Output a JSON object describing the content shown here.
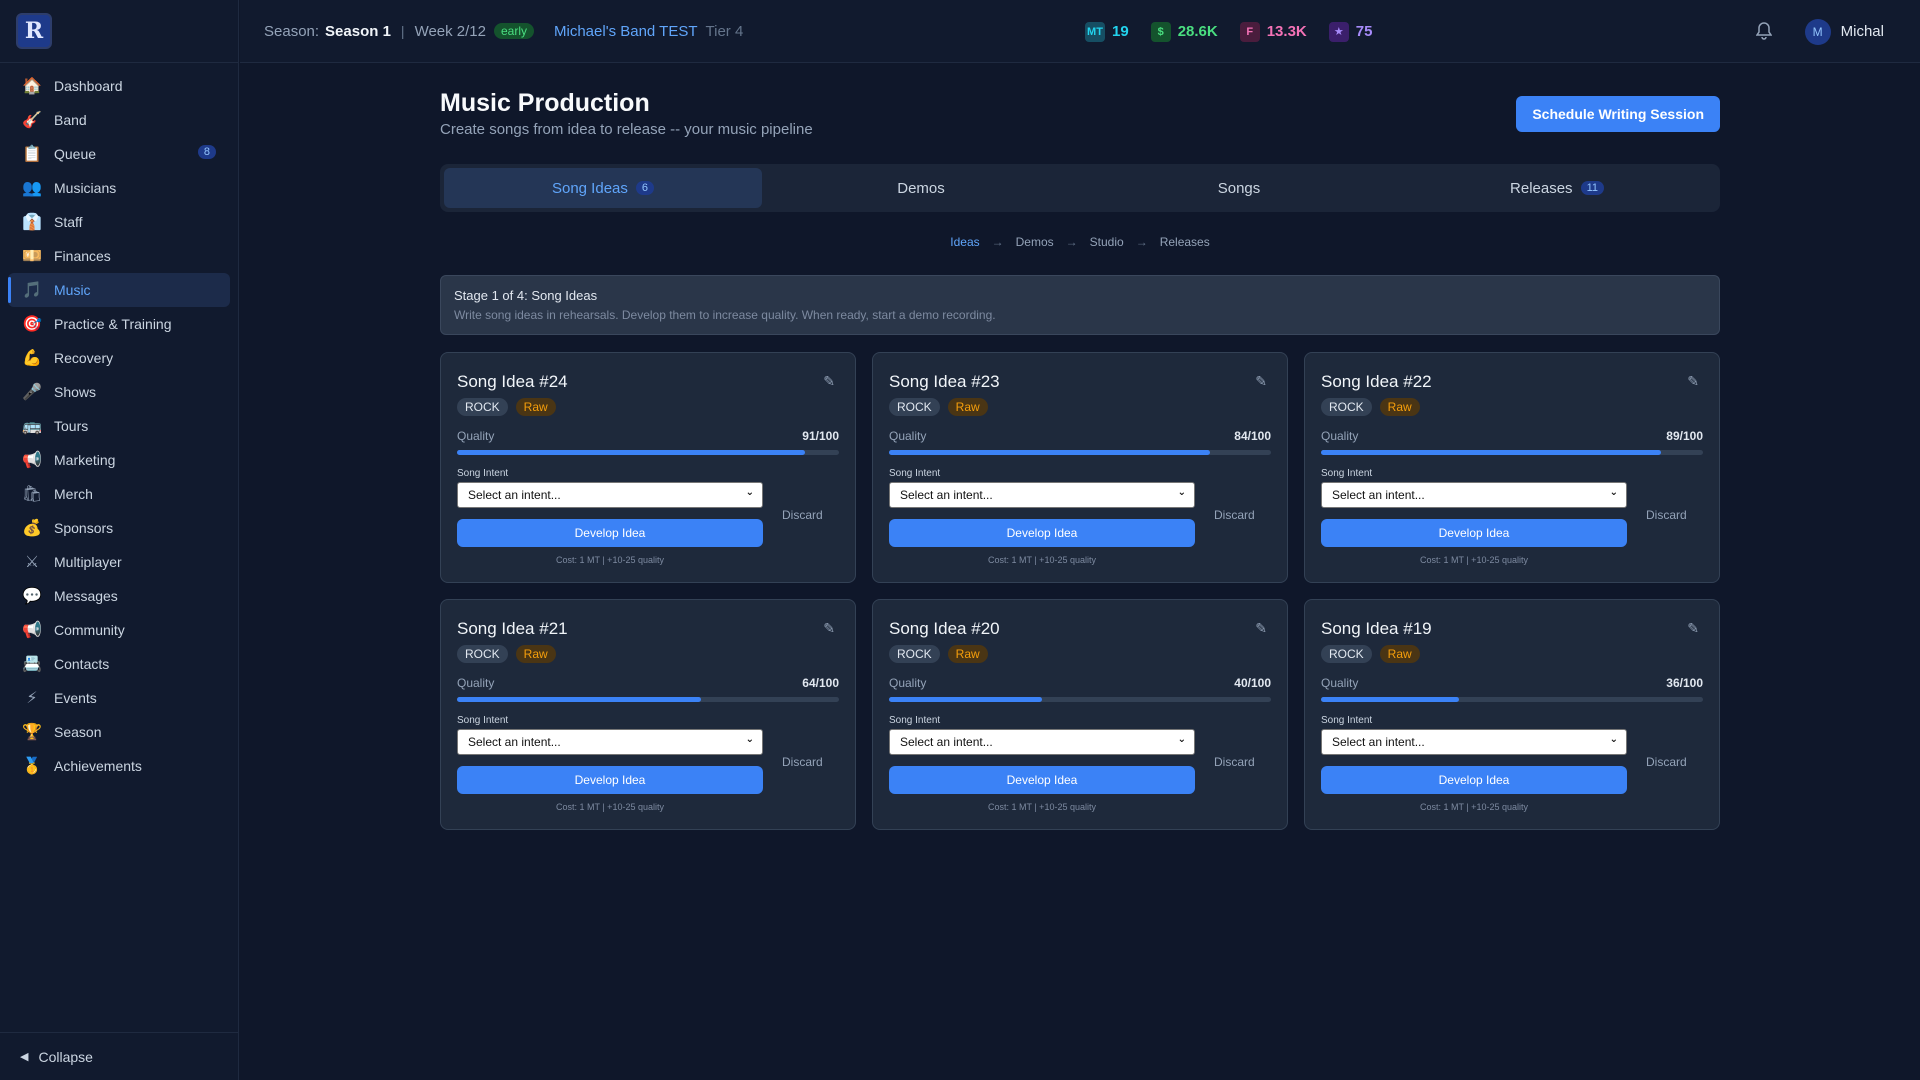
{
  "sidebar": {
    "logo_letter": "R",
    "items": [
      {
        "label": "Dashboard",
        "icon": "🏠",
        "icon_name": "home-icon"
      },
      {
        "label": "Band",
        "icon": "🎸",
        "icon_name": "guitar-icon"
      },
      {
        "label": "Queue",
        "icon": "📋",
        "icon_name": "clipboard-icon",
        "badge": "8"
      },
      {
        "label": "Musicians",
        "icon": "👥",
        "icon_name": "people-icon"
      },
      {
        "label": "Staff",
        "icon": "👔",
        "icon_name": "tie-icon"
      },
      {
        "label": "Finances",
        "icon": "💴",
        "icon_name": "money-icon"
      },
      {
        "label": "Music",
        "icon": "🎵",
        "icon_name": "music-note-icon",
        "active": true
      },
      {
        "label": "Practice & Training",
        "icon": "🎯",
        "icon_name": "target-icon"
      },
      {
        "label": "Recovery",
        "icon": "💪",
        "icon_name": "muscle-icon"
      },
      {
        "label": "Shows",
        "icon": "🎤",
        "icon_name": "microphone-icon"
      },
      {
        "label": "Tours",
        "icon": "🚌",
        "icon_name": "bus-icon"
      },
      {
        "label": "Marketing",
        "icon": "📢",
        "icon_name": "megaphone-icon"
      },
      {
        "label": "Merch",
        "icon": "🛍",
        "icon_name": "shopping-bag-icon"
      },
      {
        "label": "Sponsors",
        "icon": "💰",
        "icon_name": "money-bag-icon"
      },
      {
        "label": "Multiplayer",
        "icon": "⚔",
        "icon_name": "swords-icon"
      },
      {
        "label": "Messages",
        "icon": "💬",
        "icon_name": "chat-icon"
      },
      {
        "label": "Community",
        "icon": "📢",
        "icon_name": "megaphone-icon"
      },
      {
        "label": "Contacts",
        "icon": "📇",
        "icon_name": "card-index-icon"
      },
      {
        "label": "Events",
        "icon": "⚡",
        "icon_name": "lightning-icon"
      },
      {
        "label": "Season",
        "icon": "🏆",
        "icon_name": "trophy-icon"
      },
      {
        "label": "Achievements",
        "icon": "🥇",
        "icon_name": "medal-icon"
      }
    ],
    "collapse_label": "Collapse"
  },
  "topbar": {
    "season_label": "Season:",
    "season_value": "Season 1",
    "week": "Week 2/12",
    "phase": "early",
    "band_name": "Michael's Band TEST",
    "tier": "Tier 4",
    "stats": {
      "mt": {
        "chip": "MT",
        "value": "19"
      },
      "money": {
        "chip": "$",
        "value": "28.6K"
      },
      "fans": {
        "chip": "F",
        "value": "13.3K"
      },
      "star": {
        "chip": "★",
        "value": "75"
      }
    },
    "user_initial": "M",
    "user_name": "Michal"
  },
  "main": {
    "title": "Music Production",
    "subtitle": "Create songs from idea to release -- your music pipeline",
    "schedule_button": "Schedule Writing Session",
    "tabs": [
      {
        "label": "Song Ideas",
        "count": "6",
        "active": true
      },
      {
        "label": "Demos"
      },
      {
        "label": "Songs"
      },
      {
        "label": "Releases",
        "count": "11"
      }
    ],
    "pipeline": [
      "Ideas",
      "Demos",
      "Studio",
      "Releases"
    ],
    "stage_title": "Stage 1 of 4: Song Ideas",
    "stage_desc": "Write song ideas in rehearsals. Develop them to increase quality. When ready, start a demo recording.",
    "cards": [
      {
        "title": "Song Idea #24",
        "genre": "ROCK",
        "state": "Raw",
        "quality": 91,
        "quality_text": "91/100"
      },
      {
        "title": "Song Idea #23",
        "genre": "ROCK",
        "state": "Raw",
        "quality": 84,
        "quality_text": "84/100"
      },
      {
        "title": "Song Idea #22",
        "genre": "ROCK",
        "state": "Raw",
        "quality": 89,
        "quality_text": "89/100"
      },
      {
        "title": "Song Idea #21",
        "genre": "ROCK",
        "state": "Raw",
        "quality": 64,
        "quality_text": "64/100"
      },
      {
        "title": "Song Idea #20",
        "genre": "ROCK",
        "state": "Raw",
        "quality": 40,
        "quality_text": "40/100"
      },
      {
        "title": "Song Idea #19",
        "genre": "ROCK",
        "state": "Raw",
        "quality": 36,
        "quality_text": "36/100"
      }
    ],
    "card_labels": {
      "quality": "Quality",
      "intent": "Song Intent",
      "intent_placeholder": "Select an intent...",
      "develop": "Develop Idea",
      "discard": "Discard",
      "cost": "Cost: 1 MT | +10-25 quality"
    }
  },
  "colors": {
    "accent": "#3b82f6",
    "background": "#0f172a",
    "card": "#1e293b"
  }
}
